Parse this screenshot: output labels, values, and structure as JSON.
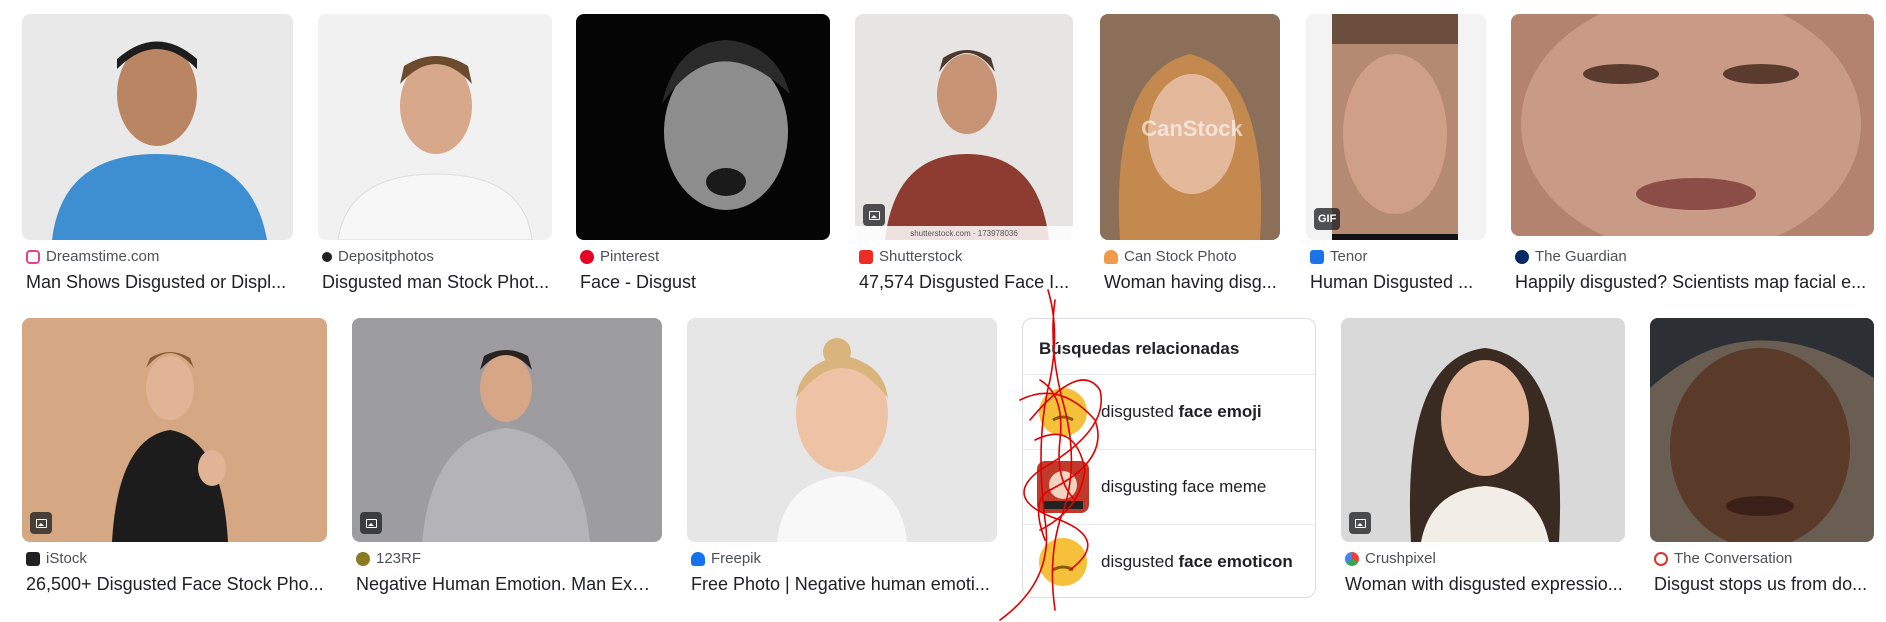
{
  "results_row1": [
    {
      "source": "Dreamstime.com",
      "title": "Man Shows Disgusted or Displ...",
      "favicon_color": "#e8418b",
      "thumb_color": "#8fb4cf",
      "badge": ""
    },
    {
      "source": "Depositphotos",
      "title": "Disgusted man Stock Phot...",
      "favicon_color": "#202124",
      "thumb_color": "#ececec",
      "badge": ""
    },
    {
      "source": "Pinterest",
      "title": "Face - Disgust",
      "favicon_color": "#e60023",
      "thumb_color": "#1a1a1a",
      "badge": ""
    },
    {
      "source": "Shutterstock",
      "title": "47,574 Disgusted Face I...",
      "favicon_color": "#ee2b24",
      "thumb_color": "#c4bfbb",
      "badge": "image",
      "watermark": "shutterstock.com · 173978036"
    },
    {
      "source": "Can Stock Photo",
      "title": "Woman having disg...",
      "favicon_color": "#f29a4b",
      "thumb_color": "#a88a70",
      "badge": "",
      "watermark": "CanStock"
    },
    {
      "source": "Tenor",
      "title": "Human Disgusted ...",
      "favicon_color": "#1a73e8",
      "thumb_color": "#c39a82",
      "badge": "GIF"
    },
    {
      "source": "The Guardian",
      "title": "Happily disgusted? Scientists map facial e...",
      "favicon_color": "#052962",
      "thumb_color": "#c79a86",
      "badge": ""
    }
  ],
  "results_row2": [
    {
      "source": "iStock",
      "title": "26,500+ Disgusted Face Stock Pho...",
      "favicon_color": "#202124",
      "thumb_color": "#d5a782",
      "badge": "image"
    },
    {
      "source": "123RF",
      "title": "Negative Human Emotion. Man Exp...",
      "favicon_color": "#8a7a20",
      "thumb_color": "#9b9b9f",
      "badge": "image"
    },
    {
      "source": "Freepik",
      "title": "Free Photo | Negative human emoti...",
      "favicon_color": "#1273eb",
      "thumb_color": "#e3e3e3",
      "badge": ""
    },
    {
      "source": "Crushpixel",
      "title": "Woman with disgusted expressio...",
      "favicon_color": "#ea4335",
      "thumb_color": "#d4d4d4",
      "badge": "image"
    },
    {
      "source": "The Conversation",
      "title": "Disgust stops us from do...",
      "favicon_color": "#d8352a",
      "thumb_color": "#5b4a3e",
      "badge": ""
    }
  ],
  "related": {
    "heading": "Búsquedas relacionadas",
    "items": [
      {
        "plain": "disgusted ",
        "bold": "face emoji"
      },
      {
        "plain": "disgusting face meme",
        "bold": ""
      },
      {
        "plain": "disgusted ",
        "bold": "face emoticon"
      }
    ]
  },
  "colors": {
    "annotation_red": "#e00000",
    "emoji_yellow": "#f5c13b"
  }
}
